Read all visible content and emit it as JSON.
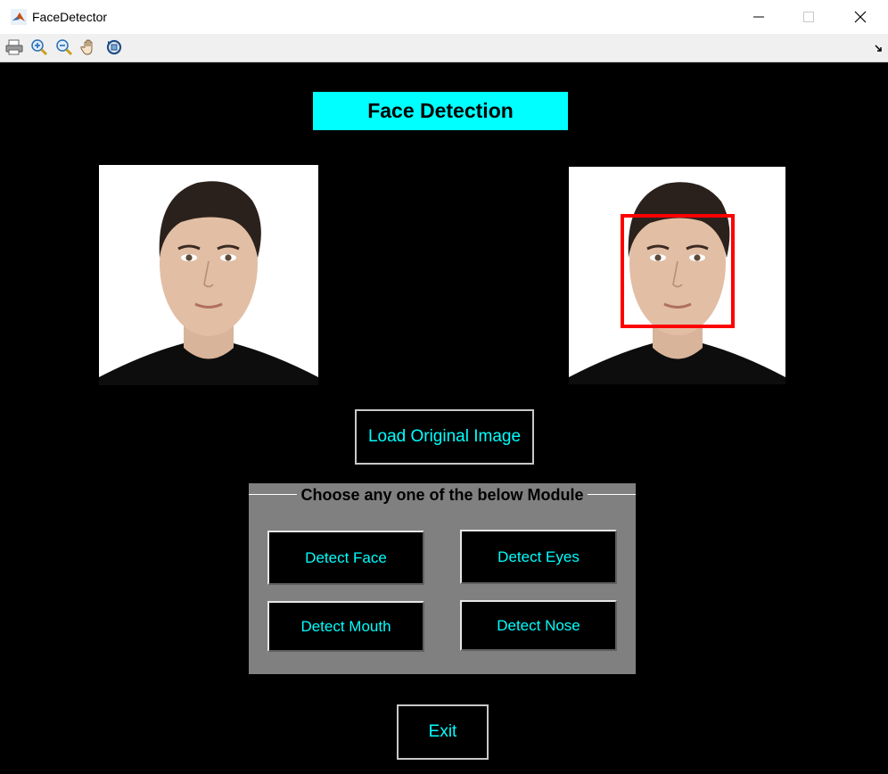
{
  "window": {
    "title": "FaceDetector",
    "icons": {
      "app": "matlab-icon",
      "minimize": "minimize-icon",
      "maximize": "maximize-icon",
      "close": "close-icon"
    }
  },
  "toolbar": {
    "tools": [
      "print-icon",
      "zoom-in-icon",
      "zoom-out-icon",
      "pan-icon",
      "rotate-3d-icon"
    ],
    "dock": "dock-arrow-icon"
  },
  "main": {
    "heading": "Face Detection",
    "load_button": "Load Original Image",
    "module_panel": {
      "title": "Choose any one of the below Module",
      "buttons": [
        "Detect Face",
        "Detect Eyes",
        "Detect Mouth",
        "Detect Nose"
      ]
    },
    "exit_button": "Exit"
  },
  "colors": {
    "background": "#000000",
    "accent": "#00ffff",
    "panel": "#808080",
    "detection_box": "#ff0000"
  }
}
